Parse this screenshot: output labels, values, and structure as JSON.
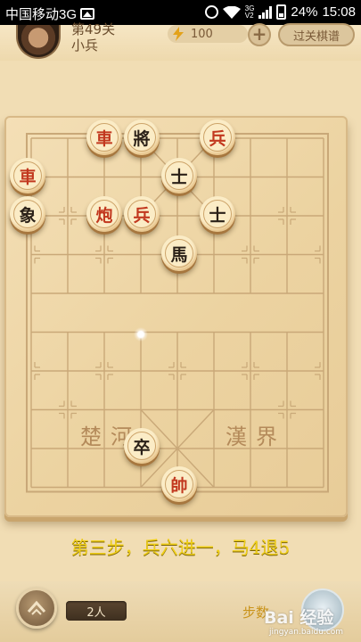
{
  "status_bar": {
    "carrier": "中国移动3G",
    "battery": "24%",
    "time": "15:08",
    "net_type": "3G",
    "net_sub": "V2"
  },
  "header": {
    "level": "第49关",
    "rank": "小兵",
    "energy": "100",
    "plus": "+",
    "guide_button": "过关棋谱"
  },
  "board": {
    "river_left": "楚河",
    "river_right": "漢界",
    "pieces": [
      {
        "name": "piece-red-chariot-1",
        "label": "車",
        "side": "red",
        "file": 1,
        "rank": 1
      },
      {
        "name": "piece-black-general",
        "label": "將",
        "side": "black",
        "file": 2,
        "rank": 1
      },
      {
        "name": "piece-red-soldier-1",
        "label": "兵",
        "side": "red",
        "file": 3,
        "rank": 1
      },
      {
        "name": "piece-red-chariot-2",
        "label": "車",
        "side": "red",
        "file": -1,
        "rank": 2
      },
      {
        "name": "piece-black-advisor-1",
        "label": "士",
        "side": "black",
        "file": 2,
        "rank": 2
      },
      {
        "name": "piece-black-elephant",
        "label": "象",
        "side": "black",
        "file": -1,
        "rank": 3
      },
      {
        "name": "piece-red-cannon",
        "label": "炮",
        "side": "red",
        "file": 1,
        "rank": 3
      },
      {
        "name": "piece-red-soldier-2",
        "label": "兵",
        "side": "red",
        "file": 2,
        "rank": 3
      },
      {
        "name": "piece-black-advisor-2",
        "label": "士",
        "side": "black",
        "file": 3,
        "rank": 3
      },
      {
        "name": "piece-black-horse",
        "label": "馬",
        "side": "black",
        "file": 2,
        "rank": 4
      },
      {
        "name": "piece-black-soldier",
        "label": "卒",
        "side": "black",
        "file": 2,
        "rank": 9
      },
      {
        "name": "piece-red-general",
        "label": "帥",
        "side": "red",
        "file": 3,
        "rank": 10
      }
    ]
  },
  "instruction": "第三步，兵六进一，马4退5",
  "footer": {
    "players": "2人",
    "steps_label": "步数",
    "watermark_text": "Bai 经验",
    "watermark_url": "jingyan.baidu.com"
  },
  "colors": {
    "instruction": "#f0cf18",
    "red_piece_text": "#c2381f",
    "black_piece_text": "#2b2118",
    "board": "#f4dfb6"
  }
}
